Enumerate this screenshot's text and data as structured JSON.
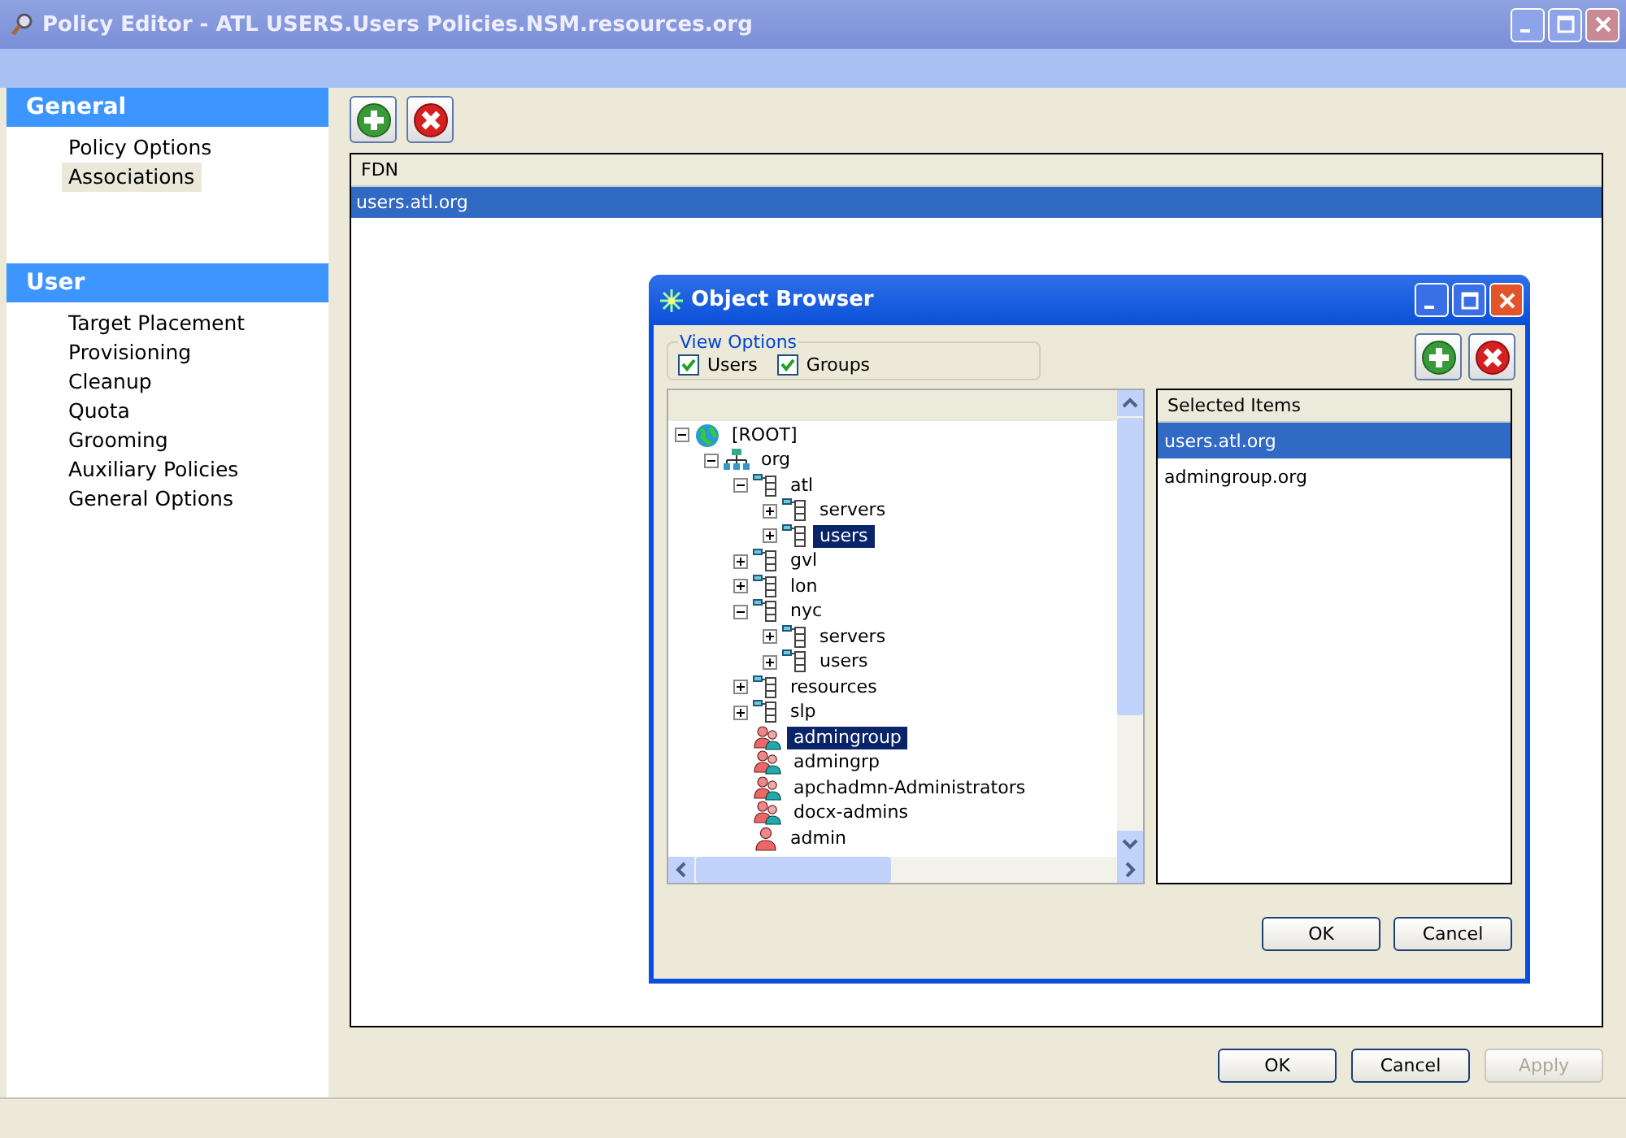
{
  "window": {
    "title": "Policy Editor - ATL USERS.Users Policies.NSM.resources.org"
  },
  "sidebar": {
    "sections": [
      {
        "title": "General",
        "items": [
          {
            "label": "Policy Options",
            "selected": false
          },
          {
            "label": "Associations",
            "selected": true
          }
        ]
      },
      {
        "title": "User",
        "items": [
          {
            "label": "Target Placement",
            "selected": false
          },
          {
            "label": "Provisioning",
            "selected": false
          },
          {
            "label": "Cleanup",
            "selected": false
          },
          {
            "label": "Quota",
            "selected": false
          },
          {
            "label": "Grooming",
            "selected": false
          },
          {
            "label": "Auxiliary Policies",
            "selected": false
          },
          {
            "label": "General Options",
            "selected": false
          }
        ]
      }
    ]
  },
  "table": {
    "columns": [
      "FDN"
    ],
    "rows": [
      {
        "cells": [
          "users.atl.org"
        ],
        "selected": true
      }
    ]
  },
  "dialog": {
    "title": "Object Browser",
    "view_options": {
      "title": "View Options",
      "checkboxes": [
        {
          "label": "Users",
          "checked": true
        },
        {
          "label": "Groups",
          "checked": true
        }
      ]
    },
    "tree": [
      {
        "label": "[ROOT]",
        "kind": "root",
        "expanded": true,
        "selected": false,
        "children": [
          {
            "label": "org",
            "kind": "org",
            "expanded": true,
            "selected": false,
            "children": [
              {
                "label": "atl",
                "kind": "container",
                "expanded": true,
                "selected": false,
                "children": [
                  {
                    "label": "servers",
                    "kind": "container",
                    "expanded": false,
                    "selected": false
                  },
                  {
                    "label": "users",
                    "kind": "container",
                    "expanded": false,
                    "selected": true
                  }
                ]
              },
              {
                "label": "gvl",
                "kind": "container",
                "expanded": false,
                "selected": false
              },
              {
                "label": "lon",
                "kind": "container",
                "expanded": false,
                "selected": false
              },
              {
                "label": "nyc",
                "kind": "container",
                "expanded": true,
                "selected": false,
                "children": [
                  {
                    "label": "servers",
                    "kind": "container",
                    "expanded": false,
                    "selected": false
                  },
                  {
                    "label": "users",
                    "kind": "container",
                    "expanded": false,
                    "selected": false
                  }
                ]
              },
              {
                "label": "resources",
                "kind": "container",
                "expanded": false,
                "selected": false
              },
              {
                "label": "slp",
                "kind": "container",
                "expanded": false,
                "selected": false
              },
              {
                "label": "admingroup",
                "kind": "group",
                "selected": true
              },
              {
                "label": "admingrp",
                "kind": "group",
                "selected": false
              },
              {
                "label": "apchadmn-Administrators",
                "kind": "group",
                "selected": false
              },
              {
                "label": "docx-admins",
                "kind": "group",
                "selected": false
              },
              {
                "label": "admin",
                "kind": "user",
                "selected": false
              }
            ]
          }
        ]
      }
    ],
    "selected_items": {
      "heading": "Selected Items",
      "rows": [
        {
          "label": "users.atl.org",
          "selected": true
        },
        {
          "label": "admingroup.org",
          "selected": false
        }
      ]
    },
    "buttons": [
      {
        "label": "OK",
        "disabled": false
      },
      {
        "label": "Cancel",
        "disabled": false
      }
    ]
  },
  "buttons": [
    {
      "label": "OK",
      "disabled": false
    },
    {
      "label": "Cancel",
      "disabled": false
    },
    {
      "label": "Apply",
      "disabled": true
    }
  ]
}
